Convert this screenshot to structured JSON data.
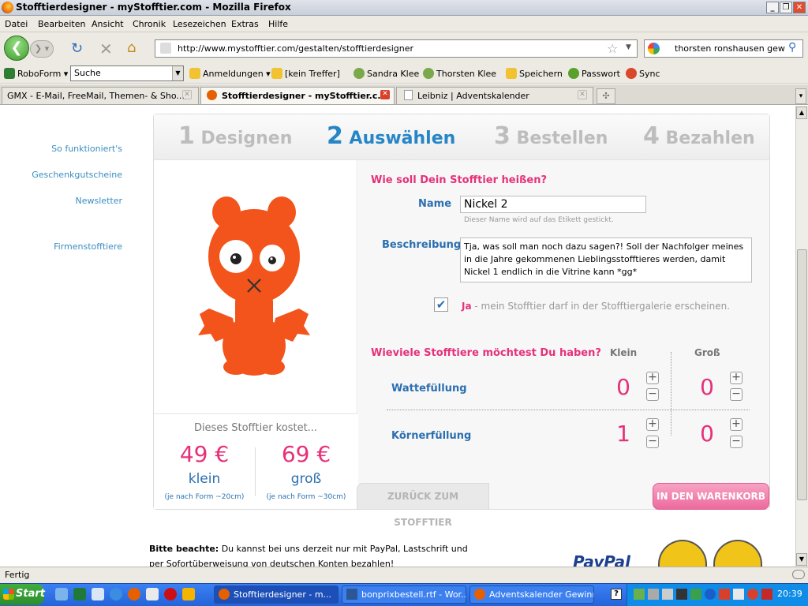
{
  "window": {
    "title": "Stofftierdesigner - myStofftier.com - Mozilla Firefox"
  },
  "menu": [
    "Datei",
    "Bearbeiten",
    "Ansicht",
    "Chronik",
    "Lesezeichen",
    "Extras",
    "Hilfe"
  ],
  "nav": {
    "url": "http://www.mystofftier.com/gestalten/stofftierdesigner",
    "search_value": "thorsten ronshausen gewinn"
  },
  "toolbar": {
    "roboform": "RoboForm",
    "search_field": "Suche",
    "items": [
      "Anmeldungen",
      "[kein Treffer]",
      "Sandra Klee",
      "Thorsten Klee",
      "Speichern",
      "Passwort",
      "Sync"
    ]
  },
  "tabs": [
    {
      "label": "GMX - E-Mail, FreeMail, Themen- & Sho..."
    },
    {
      "label": "Stofftierdesigner - myStofftier.c..."
    },
    {
      "label": "Leibniz | Adventskalender"
    }
  ],
  "sidebar": [
    "So funktioniert's",
    "Geschenkgutscheine",
    "Newsletter",
    "Firmenstofftiere"
  ],
  "steps": [
    {
      "num": "1",
      "label": "Designen"
    },
    {
      "num": "2",
      "label": "Auswählen"
    },
    {
      "num": "3",
      "label": "Bestellen"
    },
    {
      "num": "4",
      "label": "Bezahlen"
    }
  ],
  "form": {
    "heading": "Wie soll Dein Stofftier heißen?",
    "name_label": "Name",
    "name_value": "Nickel 2",
    "name_hint": "Dieser Name wird auf das Etikett gestickt.",
    "desc_label": "Beschreibung",
    "desc_value": "Tja, was soll man noch dazu sagen?! Soll der Nachfolger meines in die Jahre gekommenen Lieblingsstofftieres werden, damit Nickel 1 endlich in die Vitrine kann *gg*",
    "gallery_yes": "Ja",
    "gallery_text": " - mein Stofftier darf in der Stofftiergalerie erscheinen."
  },
  "quantity": {
    "heading": "Wieviele Stofftiere möchtest Du haben?",
    "col_small": "Klein",
    "col_large": "Groß",
    "rows": [
      {
        "label": "Wattefüllung",
        "small": "0",
        "large": "0"
      },
      {
        "label": "Körnerfüllung",
        "small": "1",
        "large": "0"
      }
    ]
  },
  "price": {
    "title": "Dieses Stofftier kostet...",
    "small_price": "49 €",
    "small_label": "klein",
    "small_note": "(je nach Form ~20cm)",
    "large_price": "69 €",
    "large_label": "groß",
    "large_note": "(je nach Form ~30cm)"
  },
  "buttons": {
    "back": "ZURÜCK ZUM STOFFTIER",
    "cart": "IN DEN WARENKORB"
  },
  "notice": {
    "bold": "Bitte beachte:",
    "line1": " Du kannst bei uns derzeit nur mit PayPal, Lastschrift und",
    "line2": "per Sofortüberweisung von deutschen Konten bezahlen!"
  },
  "paypal": "PayPal",
  "status": "Fertig",
  "taskbar": {
    "start": "Start",
    "tasks": [
      "Stofftierdesigner - m...",
      "bonprixbestell.rtf - Wor...",
      "Adventskalender Gewinn..."
    ],
    "clock": "20:39"
  },
  "colors": {
    "accent_pink": "#e6317a",
    "accent_blue": "#2585c6",
    "toy_orange": "#f2541b"
  }
}
